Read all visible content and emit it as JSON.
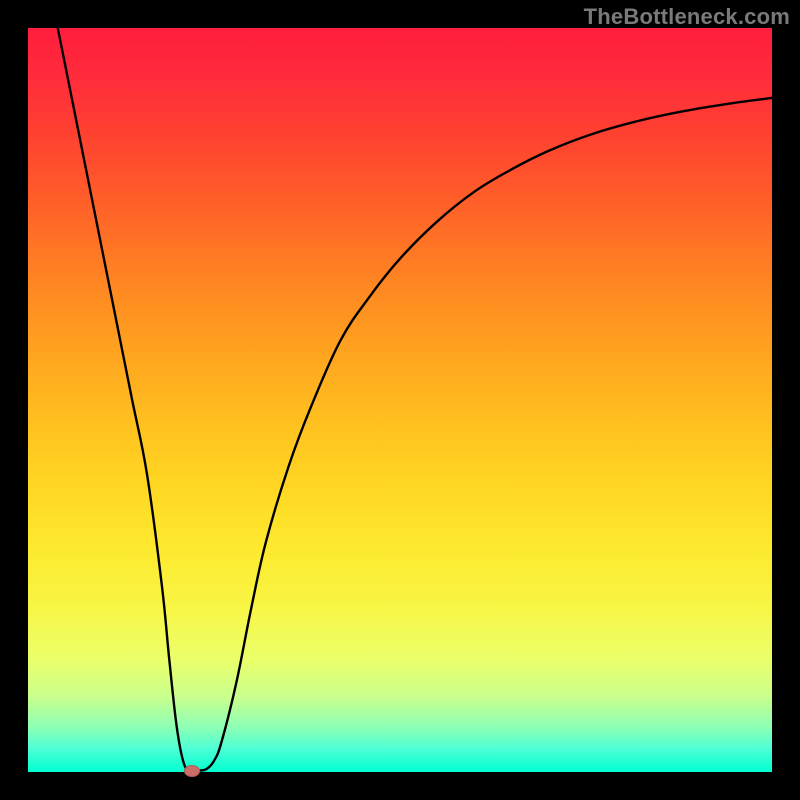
{
  "watermark": "TheBottleneck.com",
  "colors": {
    "curve_stroke": "#000000",
    "marker_fill": "#cd6d67",
    "frame_bg": "#000000"
  },
  "chart_data": {
    "type": "line",
    "title": "",
    "xlabel": "",
    "ylabel": "",
    "xlim": [
      0,
      100
    ],
    "ylim": [
      0,
      100
    ],
    "grid": false,
    "legend": false,
    "series": [
      {
        "name": "bottleneck-curve",
        "x": [
          4,
          6,
          8,
          10,
          12,
          14,
          16,
          18,
          19,
          20,
          21,
          22,
          23,
          24,
          25,
          26,
          28,
          30,
          32,
          35,
          38,
          42,
          46,
          50,
          55,
          60,
          65,
          70,
          76,
          82,
          88,
          94,
          100
        ],
        "y": [
          100,
          90,
          80,
          70,
          60,
          50,
          40,
          25,
          15,
          6,
          1,
          0.2,
          0.2,
          0.4,
          1.5,
          4,
          12,
          22,
          31,
          41,
          49,
          58,
          64,
          69,
          74,
          78,
          81,
          83.5,
          85.8,
          87.5,
          88.8,
          89.8,
          90.6
        ]
      }
    ],
    "minimum_point": {
      "x": 22,
      "y": 0.2
    }
  }
}
